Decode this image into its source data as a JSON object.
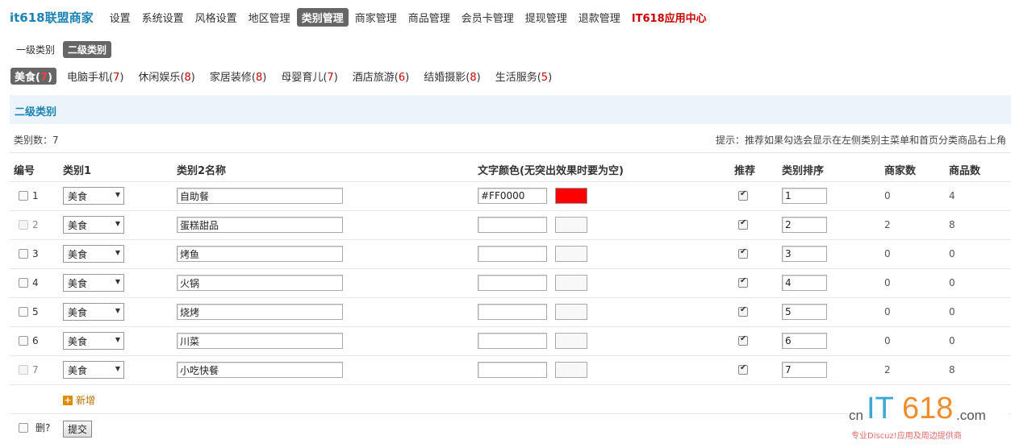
{
  "brand": "it618联盟商家",
  "nav": [
    {
      "label": "设置",
      "state": "normal"
    },
    {
      "label": "系统设置",
      "state": "normal"
    },
    {
      "label": "风格设置",
      "state": "normal"
    },
    {
      "label": "地区管理",
      "state": "normal"
    },
    {
      "label": "类别管理",
      "state": "active"
    },
    {
      "label": "商家管理",
      "state": "normal"
    },
    {
      "label": "商品管理",
      "state": "normal"
    },
    {
      "label": "会员卡管理",
      "state": "normal"
    },
    {
      "label": "提现管理",
      "state": "normal"
    },
    {
      "label": "退款管理",
      "state": "normal"
    },
    {
      "label": "IT618应用中心",
      "state": "highlight"
    }
  ],
  "subtabs": [
    {
      "label": "一级类别",
      "active": false
    },
    {
      "label": "二级类别",
      "active": true
    }
  ],
  "categories": [
    {
      "name": "美食",
      "count": "7",
      "active": true
    },
    {
      "name": "电脑手机",
      "count": "7",
      "active": false
    },
    {
      "name": "休闲娱乐",
      "count": "8",
      "active": false
    },
    {
      "name": "家居装修",
      "count": "8",
      "active": false
    },
    {
      "name": "母婴育儿",
      "count": "7",
      "active": false
    },
    {
      "name": "酒店旅游",
      "count": "6",
      "active": false
    },
    {
      "name": "结婚摄影",
      "count": "8",
      "active": false
    },
    {
      "name": "生活服务",
      "count": "5",
      "active": false
    }
  ],
  "section_title": "二级类别",
  "count_label": "类别数：7",
  "tip": "提示：推荐如果勾选会显示在左侧类别主菜单和首页分类商品右上角",
  "headers": {
    "id": "编号",
    "cat1": "类别1",
    "name": "类别2名称",
    "color": "文字颜色(无突出效果时要为空)",
    "recommend": "推荐",
    "sort": "类别排序",
    "merchants": "商家数",
    "products": "商品数"
  },
  "rows": [
    {
      "id": "1",
      "cat1": "美食",
      "name": "自助餐",
      "color": "#FF0000",
      "swatch": "#ff0000",
      "recommend": true,
      "sort": "1",
      "merchants": "0",
      "products": "4",
      "deletable": true
    },
    {
      "id": "2",
      "cat1": "美食",
      "name": "蛋糕甜品",
      "color": "",
      "swatch": "",
      "recommend": true,
      "sort": "2",
      "merchants": "2",
      "products": "8",
      "deletable": false
    },
    {
      "id": "3",
      "cat1": "美食",
      "name": "烤鱼",
      "color": "",
      "swatch": "",
      "recommend": true,
      "sort": "3",
      "merchants": "0",
      "products": "0",
      "deletable": true
    },
    {
      "id": "4",
      "cat1": "美食",
      "name": "火锅",
      "color": "",
      "swatch": "",
      "recommend": true,
      "sort": "4",
      "merchants": "0",
      "products": "0",
      "deletable": true
    },
    {
      "id": "5",
      "cat1": "美食",
      "name": "烧烤",
      "color": "",
      "swatch": "",
      "recommend": true,
      "sort": "5",
      "merchants": "0",
      "products": "0",
      "deletable": true
    },
    {
      "id": "6",
      "cat1": "美食",
      "name": "川菜",
      "color": "",
      "swatch": "",
      "recommend": true,
      "sort": "6",
      "merchants": "0",
      "products": "0",
      "deletable": true
    },
    {
      "id": "7",
      "cat1": "美食",
      "name": "小吃快餐",
      "color": "",
      "swatch": "",
      "recommend": true,
      "sort": "7",
      "merchants": "2",
      "products": "8",
      "deletable": false
    }
  ],
  "add_new": "新增",
  "delete_label": "删?",
  "submit": "提交",
  "logo": {
    "cn": "cn",
    "it": "IT",
    "num": "618",
    "com": ".com",
    "slogan": "专业Discuz!应用及周边提供商"
  }
}
